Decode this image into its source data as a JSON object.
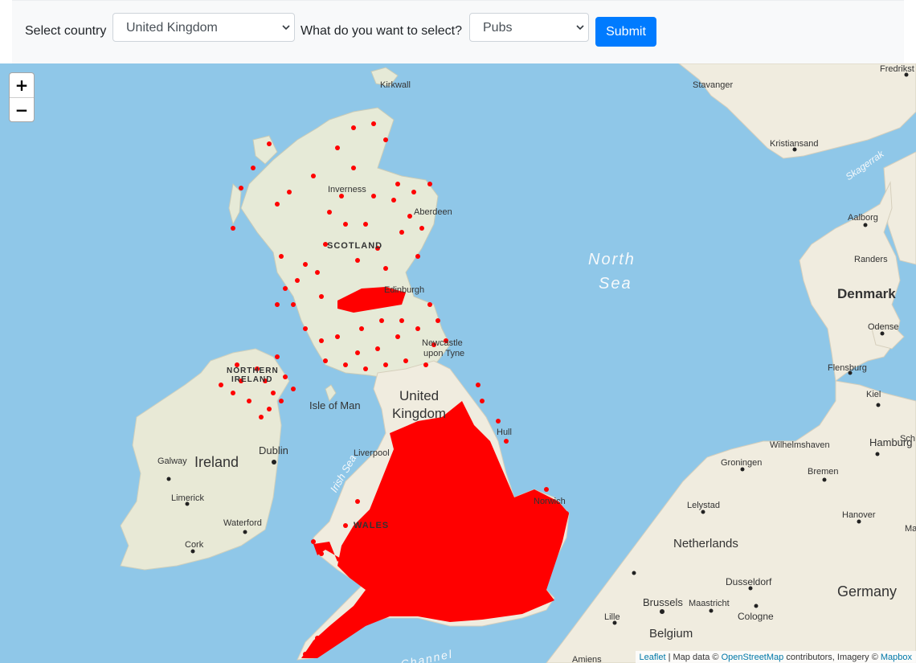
{
  "header": {
    "country_label": "Select country",
    "country_value": "United Kingdom",
    "what_label": "What do you want to select?",
    "what_value": "Pubs",
    "submit_label": "Submit"
  },
  "map": {
    "zoom_in": "+",
    "zoom_out": "−",
    "marker_color": "#ff0000",
    "water_color": "#8fc7e8",
    "labels": {
      "kirkwall": "Kirkwall",
      "stavanger": "Stavanger",
      "fredrikstad": "Fredrikst",
      "kristiansand": "Kristiansand",
      "skagerrak": "Skagerrak",
      "inverness": "Inverness",
      "aberdeen": "Aberdeen",
      "scotland": "SCOTLAND",
      "edinburgh": "Edinburgh",
      "north_sea_1": "North",
      "north_sea_2": "Sea",
      "aalborg": "Aalborg",
      "randers": "Randers",
      "denmark": "Denmark",
      "odense": "Odense",
      "newcastle_1": "Newcastle",
      "newcastle_2": "upon Tyne",
      "northern_ireland_1": "NORTHERN",
      "northern_ireland_2": "IRELAND",
      "isle_of_man": "Isle of Man",
      "united_1": "United",
      "united_2": "Kingdom",
      "hull": "Hull",
      "flensburg": "Flensburg",
      "kiel": "Kiel",
      "wilhelmshaven": "Wilhelmshaven",
      "hamburg": "Hamburg",
      "schwerin": "Sch",
      "dublin": "Dublin",
      "galway": "Galway",
      "ireland": "Ireland",
      "irish_sea": "Irish Sea",
      "liverpool": "Liverpool",
      "groningen": "Groningen",
      "bremen": "Bremen",
      "limerick": "Limerick",
      "norwich": "Norwich",
      "lelystad": "Lelystad",
      "hanover": "Hanover",
      "magdeburg": "Ma",
      "wales": "WALES",
      "waterford": "Waterford",
      "cork": "Cork",
      "netherlands": "Netherlands",
      "dusseldorf": "Dusseldorf",
      "brussels": "Brussels",
      "maastricht": "Maastricht",
      "cologne": "Cologne",
      "germany": "Germany",
      "lille": "Lille",
      "belgium": "Belgium",
      "amiens": "Amiens",
      "channel": "Channel"
    }
  },
  "attribution": {
    "leaflet": "Leaflet",
    "sep": " | Map data © ",
    "osm": "OpenStreetMap",
    "mid": " contributors, Imagery © ",
    "mapbox": "Mapbox"
  }
}
